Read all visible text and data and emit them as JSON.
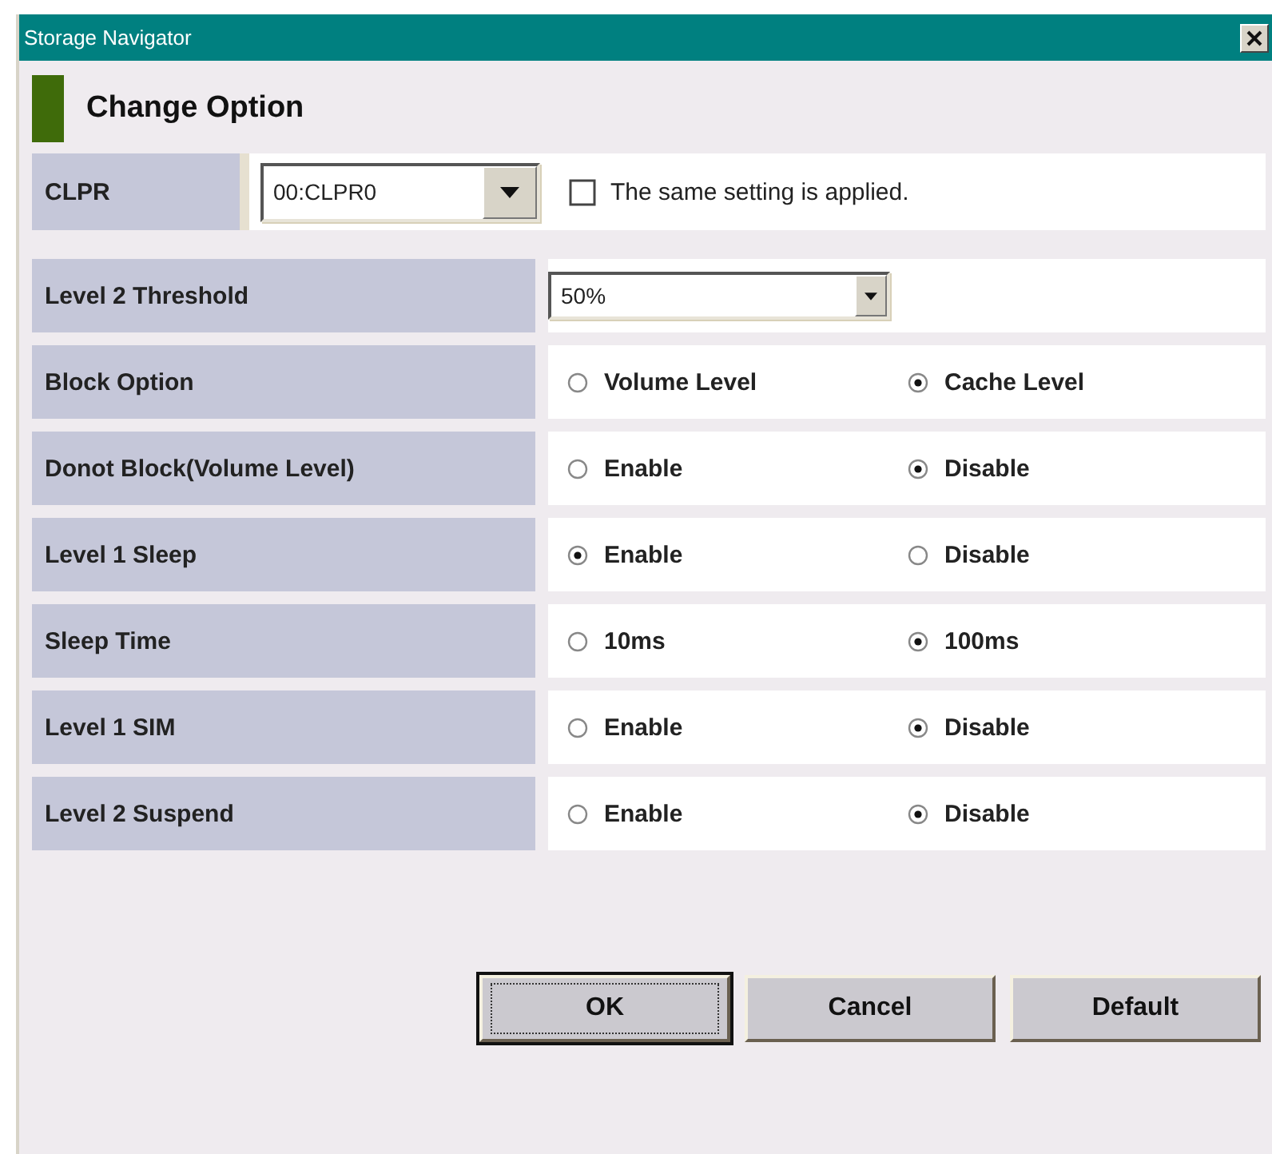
{
  "window": {
    "title": "Storage Navigator"
  },
  "heading": "Change Option",
  "clpr": {
    "label": "CLPR",
    "value": "00:CLPR0",
    "same_setting": {
      "label": "The same setting is applied.",
      "checked": false
    }
  },
  "threshold": {
    "label": "Level 2 Threshold",
    "value": "50%"
  },
  "options": [
    {
      "label": "Block Option",
      "choices": [
        {
          "label": "Volume Level",
          "selected": false
        },
        {
          "label": "Cache Level",
          "selected": true
        }
      ]
    },
    {
      "label": "Donot Block(Volume Level)",
      "choices": [
        {
          "label": "Enable",
          "selected": false
        },
        {
          "label": "Disable",
          "selected": true
        }
      ]
    },
    {
      "label": "Level 1 Sleep",
      "choices": [
        {
          "label": "Enable",
          "selected": true
        },
        {
          "label": "Disable",
          "selected": false
        }
      ]
    },
    {
      "label": "Sleep Time",
      "choices": [
        {
          "label": "10ms",
          "selected": false
        },
        {
          "label": "100ms",
          "selected": true
        }
      ]
    },
    {
      "label": "Level 1 SIM",
      "choices": [
        {
          "label": "Enable",
          "selected": false
        },
        {
          "label": "Disable",
          "selected": true
        }
      ]
    },
    {
      "label": "Level 2 Suspend",
      "choices": [
        {
          "label": "Enable",
          "selected": false
        },
        {
          "label": "Disable",
          "selected": true
        }
      ]
    }
  ],
  "buttons": [
    {
      "label": "OK",
      "focused": true
    },
    {
      "label": "Cancel",
      "focused": false
    },
    {
      "label": "Default",
      "focused": false
    }
  ]
}
